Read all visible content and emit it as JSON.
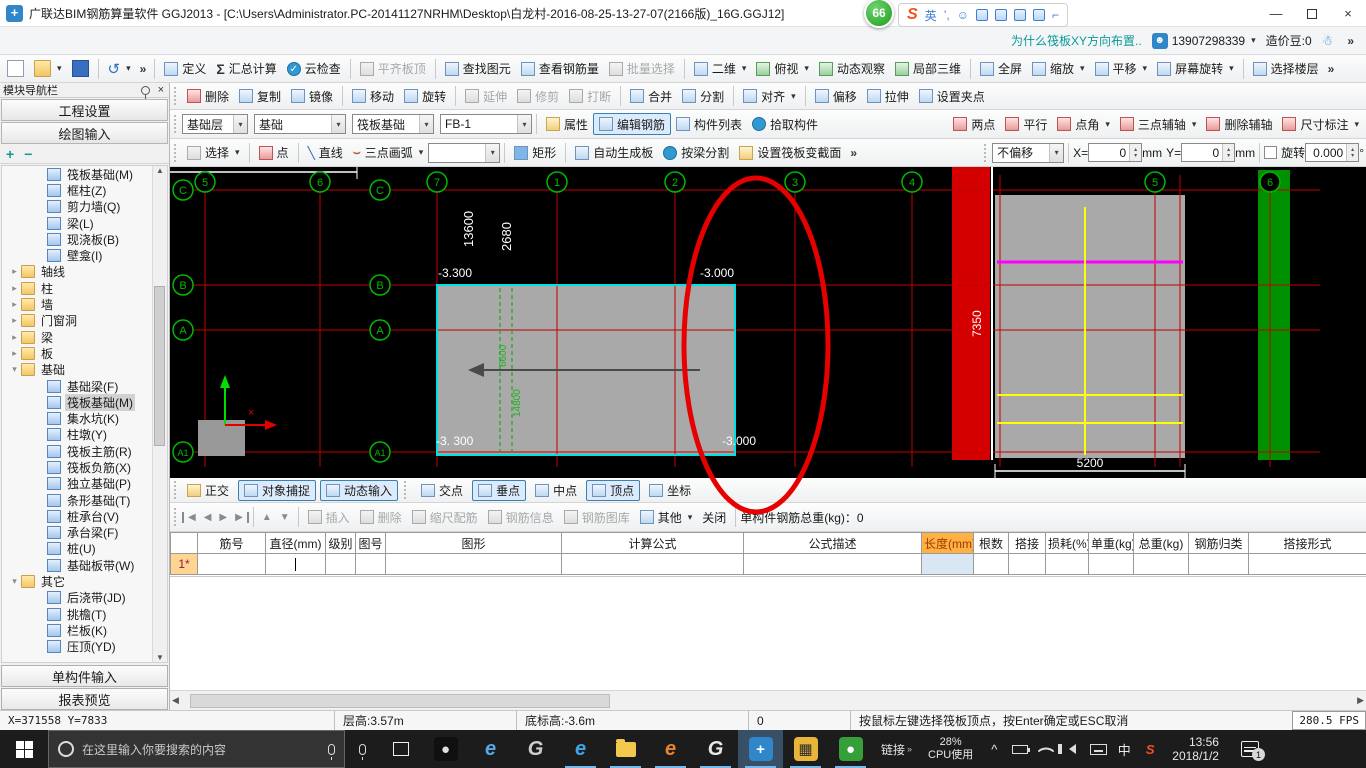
{
  "icons": {
    "dropdown": "▾",
    "chevron": "»",
    "sigma": "Σ",
    "check": "✓",
    "undo": "↺",
    "nav_first": "◀",
    "nav_prev": "◀",
    "nav_next": "▶",
    "nav_last": "▶",
    "up": "▲",
    "down": "▼",
    "close": "×",
    "min": "—",
    "cross": "×"
  },
  "window": {
    "title": "广联达BIM钢筋算量软件 GGJ2013 - [C:\\Users\\Administrator.PC-20141127NRHM\\Desktop\\白龙村-2016-08-25-13-27-07(2166版)_16G.GGJ12]",
    "badge": "66",
    "ime_logo": "S",
    "ime_lang": "英"
  },
  "infobar": {
    "question": "为什么筏板XY方向布置..",
    "phone": "13907298339",
    "beans": "造价豆:0",
    "more": "»"
  },
  "toolbar_main": {
    "items": [
      {
        "label": "定义",
        "disabled": false
      },
      {
        "label": "汇总计算",
        "disabled": false
      },
      {
        "label": "云检查",
        "disabled": false
      },
      {
        "label": "平齐板顶",
        "disabled": true
      },
      {
        "label": "查找图元",
        "disabled": false
      },
      {
        "label": "查看钢筋量",
        "disabled": false
      },
      {
        "label": "批量选择",
        "disabled": true
      }
    ],
    "view": [
      {
        "label": "二维",
        "dd": true
      },
      {
        "label": "俯视",
        "dd": true
      },
      {
        "label": "动态观察",
        "dd": false
      },
      {
        "label": "局部三维",
        "dd": false
      },
      {
        "label": "全屏",
        "dd": false
      },
      {
        "label": "缩放",
        "dd": true
      },
      {
        "label": "平移",
        "dd": true
      },
      {
        "label": "屏幕旋转",
        "dd": true
      },
      {
        "label": "选择楼层",
        "dd": false
      }
    ]
  },
  "toolbar_edit": [
    {
      "label": "删除",
      "disabled": false
    },
    {
      "label": "复制",
      "disabled": false
    },
    {
      "label": "镜像",
      "disabled": false
    },
    {
      "label": "移动",
      "disabled": false
    },
    {
      "label": "旋转",
      "disabled": false
    },
    {
      "label": "延伸",
      "disabled": true
    },
    {
      "label": "修剪",
      "disabled": true
    },
    {
      "label": "打断",
      "disabled": true
    },
    {
      "label": "合并",
      "disabled": false
    },
    {
      "label": "分割",
      "disabled": false
    },
    {
      "label": "对齐",
      "disabled": false,
      "dd": true
    },
    {
      "label": "偏移",
      "disabled": false
    },
    {
      "label": "拉伸",
      "disabled": false
    },
    {
      "label": "设置夹点",
      "disabled": false
    }
  ],
  "toolbar_component": {
    "floor": "基础层",
    "category": "基础",
    "element": "筏板基础",
    "name": "FB-1",
    "props": "属性",
    "edit_rebar": "编辑钢筋",
    "component_list": "构件列表",
    "pick": "拾取构件",
    "axis": [
      {
        "label": "两点",
        "dd": false
      },
      {
        "label": "平行",
        "dd": false
      },
      {
        "label": "点角",
        "dd": true
      },
      {
        "label": "三点辅轴",
        "dd": true
      },
      {
        "label": "删除辅轴",
        "dd": false
      },
      {
        "label": "尺寸标注",
        "dd": true
      }
    ]
  },
  "toolbar_draw": {
    "select": "选择",
    "point": "点",
    "line": "直线",
    "arc": "三点画弧",
    "arc_extra": "",
    "rect": "矩形",
    "auto": "自动生成板",
    "split": "按梁分割",
    "section": "设置筏板变截面",
    "offset_mode": "不偏移",
    "x_label": "X=",
    "x_value": "0",
    "mm1": "mm",
    "y_label": "Y=",
    "y_value": "0",
    "mm2": "mm",
    "rotate_label": "旋转",
    "rotate_value": "0.000",
    "deg": "°"
  },
  "sidebar": {
    "title": "模块导航栏",
    "sections": [
      "工程设置",
      "绘图输入"
    ],
    "expand_all": "+",
    "collapse_all": "−",
    "tree": [
      {
        "label": "筏板基础(M)",
        "level": 2,
        "kind": "item"
      },
      {
        "label": "框柱(Z)",
        "level": 2,
        "kind": "item"
      },
      {
        "label": "剪力墙(Q)",
        "level": 2,
        "kind": "item"
      },
      {
        "label": "梁(L)",
        "level": 2,
        "kind": "item"
      },
      {
        "label": "现浇板(B)",
        "level": 2,
        "kind": "item"
      },
      {
        "label": "壁龛(I)",
        "level": 2,
        "kind": "item"
      },
      {
        "label": "轴线",
        "level": 1,
        "kind": "folder",
        "expanded": false
      },
      {
        "label": "柱",
        "level": 1,
        "kind": "folder",
        "expanded": false
      },
      {
        "label": "墙",
        "level": 1,
        "kind": "folder",
        "expanded": false
      },
      {
        "label": "门窗洞",
        "level": 1,
        "kind": "folder",
        "expanded": false
      },
      {
        "label": "梁",
        "level": 1,
        "kind": "folder",
        "expanded": false
      },
      {
        "label": "板",
        "level": 1,
        "kind": "folder",
        "expanded": false
      },
      {
        "label": "基础",
        "level": 1,
        "kind": "folder",
        "expanded": true
      },
      {
        "label": "基础梁(F)",
        "level": 2,
        "kind": "item"
      },
      {
        "label": "筏板基础(M)",
        "level": 2,
        "kind": "item",
        "selected": true
      },
      {
        "label": "集水坑(K)",
        "level": 2,
        "kind": "item"
      },
      {
        "label": "柱墩(Y)",
        "level": 2,
        "kind": "item"
      },
      {
        "label": "筏板主筋(R)",
        "level": 2,
        "kind": "item"
      },
      {
        "label": "筏板负筋(X)",
        "level": 2,
        "kind": "item"
      },
      {
        "label": "独立基础(P)",
        "level": 2,
        "kind": "item"
      },
      {
        "label": "条形基础(T)",
        "level": 2,
        "kind": "item"
      },
      {
        "label": "桩承台(V)",
        "level": 2,
        "kind": "item"
      },
      {
        "label": "承台梁(F)",
        "level": 2,
        "kind": "item"
      },
      {
        "label": "桩(U)",
        "level": 2,
        "kind": "item"
      },
      {
        "label": "基础板带(W)",
        "level": 2,
        "kind": "item"
      },
      {
        "label": "其它",
        "level": 1,
        "kind": "folder",
        "expanded": true
      },
      {
        "label": "后浇带(JD)",
        "level": 2,
        "kind": "item"
      },
      {
        "label": "挑檐(T)",
        "level": 2,
        "kind": "item"
      },
      {
        "label": "栏板(K)",
        "level": 2,
        "kind": "item"
      },
      {
        "label": "压顶(YD)",
        "level": 2,
        "kind": "item"
      }
    ],
    "bottom": [
      "单构件输入",
      "报表预览"
    ]
  },
  "snapbar": [
    {
      "label": "正交",
      "boxed": false
    },
    {
      "label": "对象捕捉",
      "boxed": true
    },
    {
      "label": "动态输入",
      "boxed": true
    },
    {
      "label": "交点",
      "boxed": false
    },
    {
      "label": "垂点",
      "boxed": true
    },
    {
      "label": "中点",
      "boxed": false
    },
    {
      "label": "顶点",
      "boxed": true
    },
    {
      "label": "坐标",
      "boxed": false
    }
  ],
  "rebar": {
    "buttons": [
      "插入",
      "删除",
      "缩尺配筋",
      "钢筋信息",
      "钢筋图库",
      "其他",
      "关闭"
    ],
    "total_label": "单构件钢筋总重(kg)：0",
    "row_label": "1*",
    "columns": [
      "筋号",
      "直径(mm)",
      "级别",
      "图号",
      "图形",
      "计算公式",
      "公式描述",
      "长度(mm)",
      "根数",
      "搭接",
      "损耗(%)",
      "单重(kg)",
      "总重(kg)",
      "钢筋归类",
      "搭接形式"
    ]
  },
  "canvas": {
    "bubbles_top": [
      "5",
      "6",
      "7",
      "1",
      "2",
      "3",
      "4",
      "5",
      "6"
    ],
    "bubbles_left": [
      "C",
      "B",
      "A",
      "A1"
    ],
    "bubbles_mid": [
      "C",
      "B",
      "A",
      "A1"
    ],
    "dim_13600": "13600",
    "dim_2680": "2680",
    "dim_7350": "7350",
    "dim_5200": "5200",
    "elev_tl": "-3.300",
    "elev_tr": "-3.000",
    "elev_bl": "-3. 300",
    "elev_br": "-3.000",
    "slab_text1": "6600",
    "slab_text2": "14800",
    "colors": {
      "grid": "#c40000",
      "bubble": "#00b800",
      "slab_fill": "#a9a9a9",
      "slab_border": "#00e0e0",
      "band": "#d40000",
      "green_strip": "#009100",
      "yellow": "#ffff00",
      "magenta": "#ff00ff",
      "annotation": "#e60000"
    }
  },
  "statusbar": {
    "coords": "X=371558 Y=7833",
    "floor": "层高:3.57m",
    "elev": "底标高:-3.6m",
    "zero": "0",
    "hint": "按鼠标左键选择筏板顶点，按Enter确定或ESC取消",
    "fps": "280.5 FPS"
  },
  "taskbar": {
    "search_placeholder": "在这里输入你要搜索的内容",
    "links": "链接",
    "cpu_pct": "28%",
    "cpu_label": "CPU使用",
    "ime": "中",
    "ime_logo": "S",
    "time": "13:56",
    "date": "2018/1/2",
    "notif_count": "1",
    "apps": [
      {
        "name": "media-app",
        "glyph": "●",
        "fg": "#e0e0e0",
        "bg": "#101010",
        "chip": true,
        "underline": false,
        "active": false
      },
      {
        "name": "ie-browser",
        "glyph": "e",
        "fg": "#55a9e8",
        "chip": false,
        "underline": false,
        "active": false
      },
      {
        "name": "grey-g-app",
        "glyph": "G",
        "fg": "#cfcfcf",
        "chip": false,
        "underline": false,
        "active": false
      },
      {
        "name": "edge-browser",
        "glyph": "e",
        "fg": "#3ca6e8",
        "chip": false,
        "underline": true,
        "active": false
      },
      {
        "name": "file-explorer",
        "glyph": "",
        "fg": "#f2c94c",
        "chip": false,
        "underline": true,
        "active": false,
        "folder": true
      },
      {
        "name": "orange-e-browser",
        "glyph": "e",
        "fg": "#e8842f",
        "chip": false,
        "underline": true,
        "active": false
      },
      {
        "name": "chrome-browser",
        "glyph": "G",
        "fg": "#e8e8e8",
        "chip": false,
        "underline": true,
        "active": false
      },
      {
        "name": "ggj-app",
        "glyph": "+",
        "fg": "#ffffff",
        "bg": "#2f86c8",
        "chip": true,
        "underline": true,
        "active": true
      },
      {
        "name": "wps-spreadsheet",
        "glyph": "▦",
        "fg": "#2a2a2a",
        "bg": "#e8b53a",
        "chip": true,
        "underline": true,
        "active": false
      },
      {
        "name": "green-app",
        "glyph": "●",
        "fg": "#ffffff",
        "bg": "#35a03a",
        "chip": true,
        "underline": true,
        "active": false
      }
    ]
  }
}
